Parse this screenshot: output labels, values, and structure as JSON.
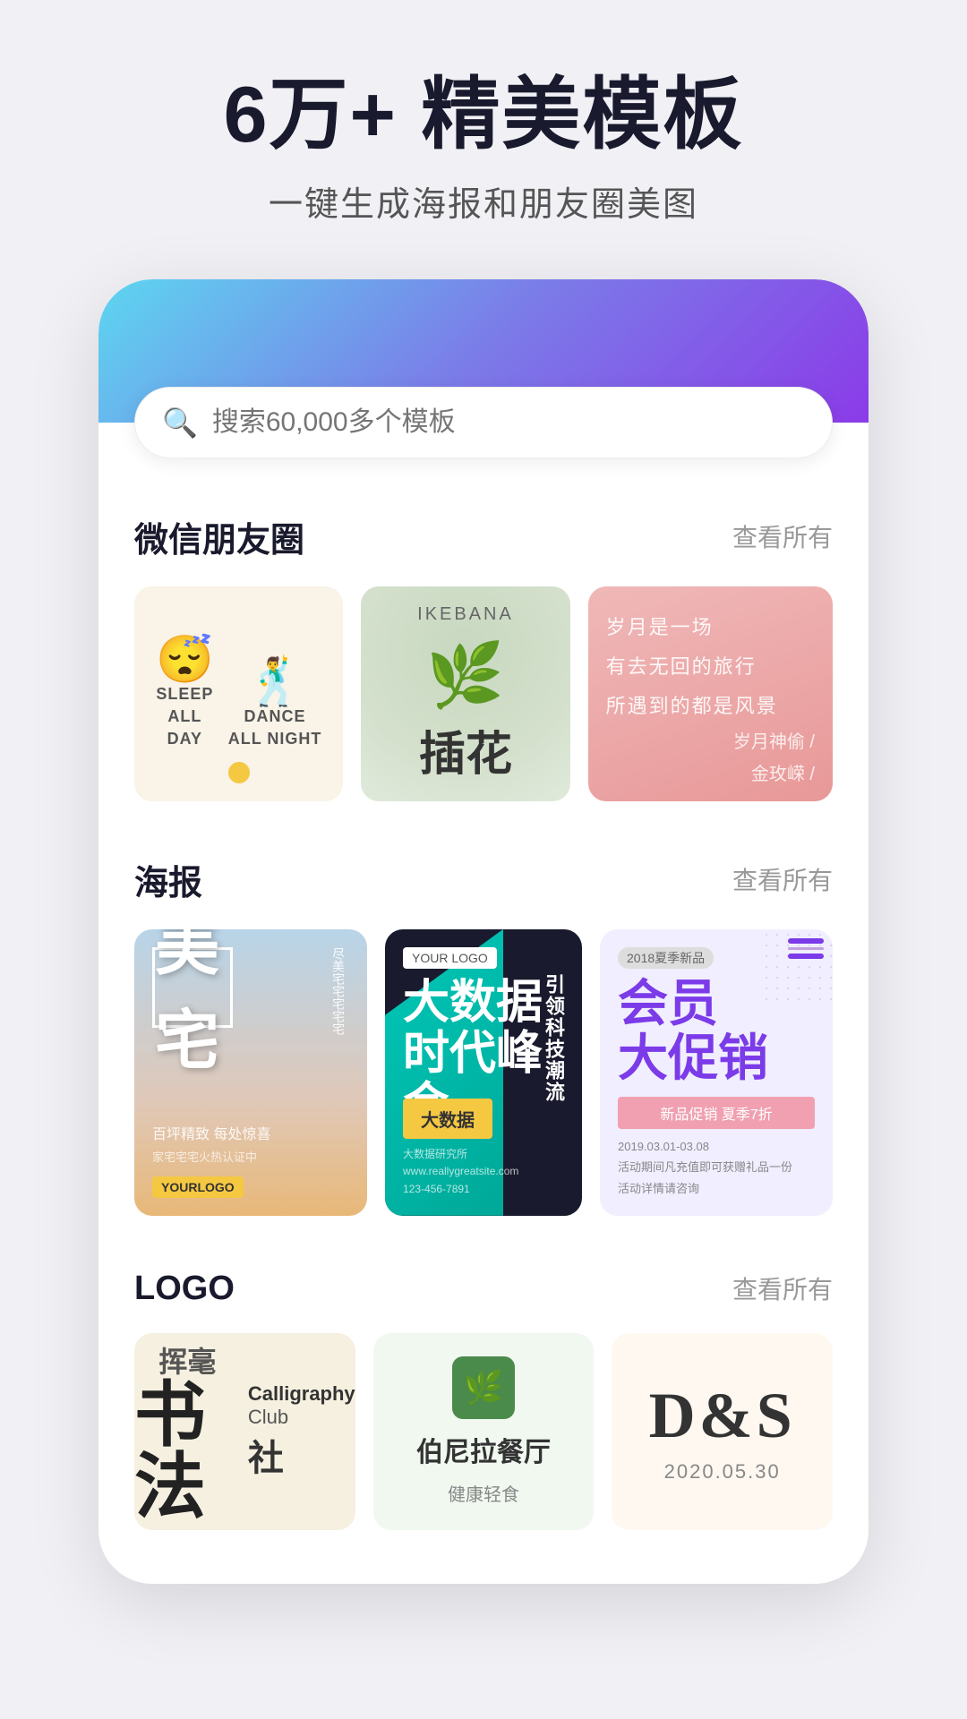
{
  "hero": {
    "title": "6万+ 精美模板",
    "subtitle": "一键生成海报和朋友圈美图"
  },
  "search": {
    "placeholder": "搜索60,000多个模板"
  },
  "sections": {
    "wechat": {
      "title": "微信朋友圈",
      "link": "查看所有",
      "cards": [
        {
          "type": "sleep_dance",
          "text1_line1": "SLEEP",
          "text1_line2": "ALL",
          "text1_line3": "DAY",
          "text2_line1": "DANCE",
          "text2_line2": "ALL NIGHT"
        },
        {
          "type": "ikebana",
          "en": "IKEBANA",
          "zh": "插花"
        },
        {
          "type": "poem",
          "lines": [
            "岁月是一场",
            "有去无回的旅行",
            "所遇到的都是风景"
          ],
          "author1": "岁月神偷 /",
          "author2": "金玫嵘 /"
        }
      ]
    },
    "poster": {
      "title": "海报",
      "link": "查看所有",
      "cards": [
        {
          "type": "meizhai",
          "title": "美宅",
          "sub_text": "尽美宅宅宅宅",
          "brand_text": "百坪精致 每处惊喜",
          "date": "家宅宅宅火热认证中",
          "your_logo": "YOURLOGO"
        },
        {
          "type": "summit",
          "logo": "YOUR LOGO",
          "main": "时代峰会",
          "side": "引领科技潮流",
          "sub": "大数据",
          "cta": "大数据",
          "info": "大数据研究/大数据研究所\nwww.reallygreatsite.com\n123-456-7891"
        },
        {
          "type": "member",
          "tag": "2018夏季新品",
          "title": "会员\n大促销",
          "subtitle": "新品促销 夏季7折",
          "pink_bar": "新品促销 夏季7折",
          "details": "2019.03.01-03.08\n活动期间凡充值即可获赠礼品一份\n活动详情请咨询"
        }
      ]
    },
    "logo": {
      "title": "LOGO",
      "link": "查看所有",
      "cards": [
        {
          "type": "calligraphy",
          "zh_big": "书法",
          "zh_brush": "挥毫",
          "en1": "Calligraphy",
          "en2": "Club",
          "zh_she": "社"
        },
        {
          "type": "restaurant",
          "name": "伯尼拉餐厅",
          "sub": "健康轻食"
        },
        {
          "type": "ds",
          "text": "D&S",
          "date": "2020.05.30"
        }
      ]
    }
  }
}
